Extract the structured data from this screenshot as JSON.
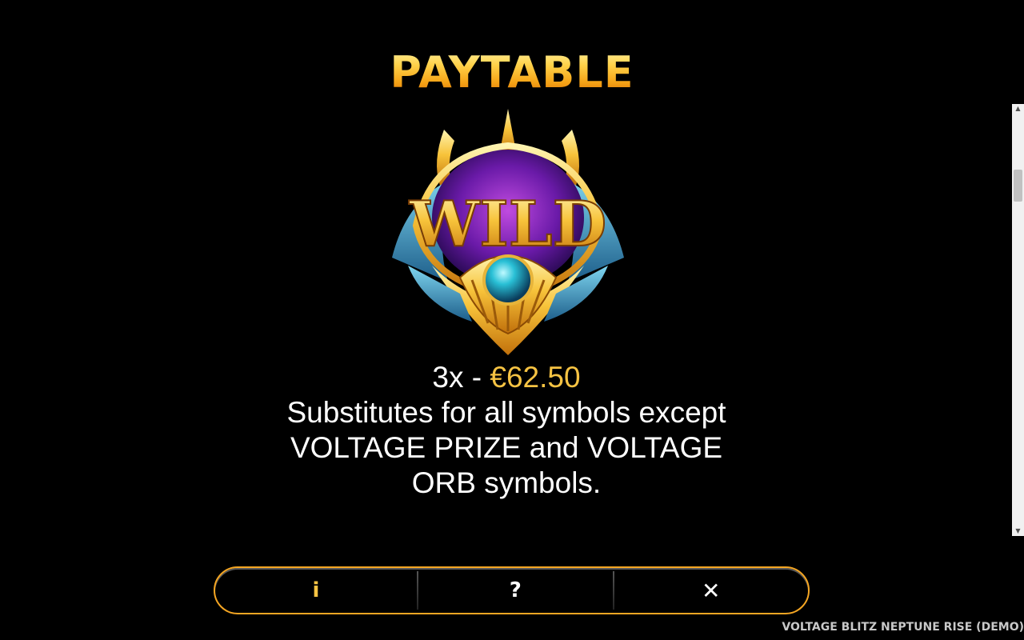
{
  "paytable": {
    "title": "PAYTABLE"
  },
  "symbol": {
    "name": "WILD",
    "count": "3x",
    "separator": "-",
    "payout": "€62.50",
    "description": "Substitutes for all symbols except VOLTAGE PRIZE and VOLTAGE ORB symbols."
  },
  "nav": {
    "info_icon": "info-icon",
    "info_glyph": "i",
    "help_icon": "help-icon",
    "help_glyph": "?",
    "close_icon": "close-icon",
    "close_glyph": "✕"
  },
  "footer": {
    "game_name": "VOLTAGE BLITZ NEPTUNE RISE (DEMO)"
  },
  "colors": {
    "accent_gold": "#f6c343",
    "nav_border": "#f5a623",
    "background": "#000000"
  }
}
